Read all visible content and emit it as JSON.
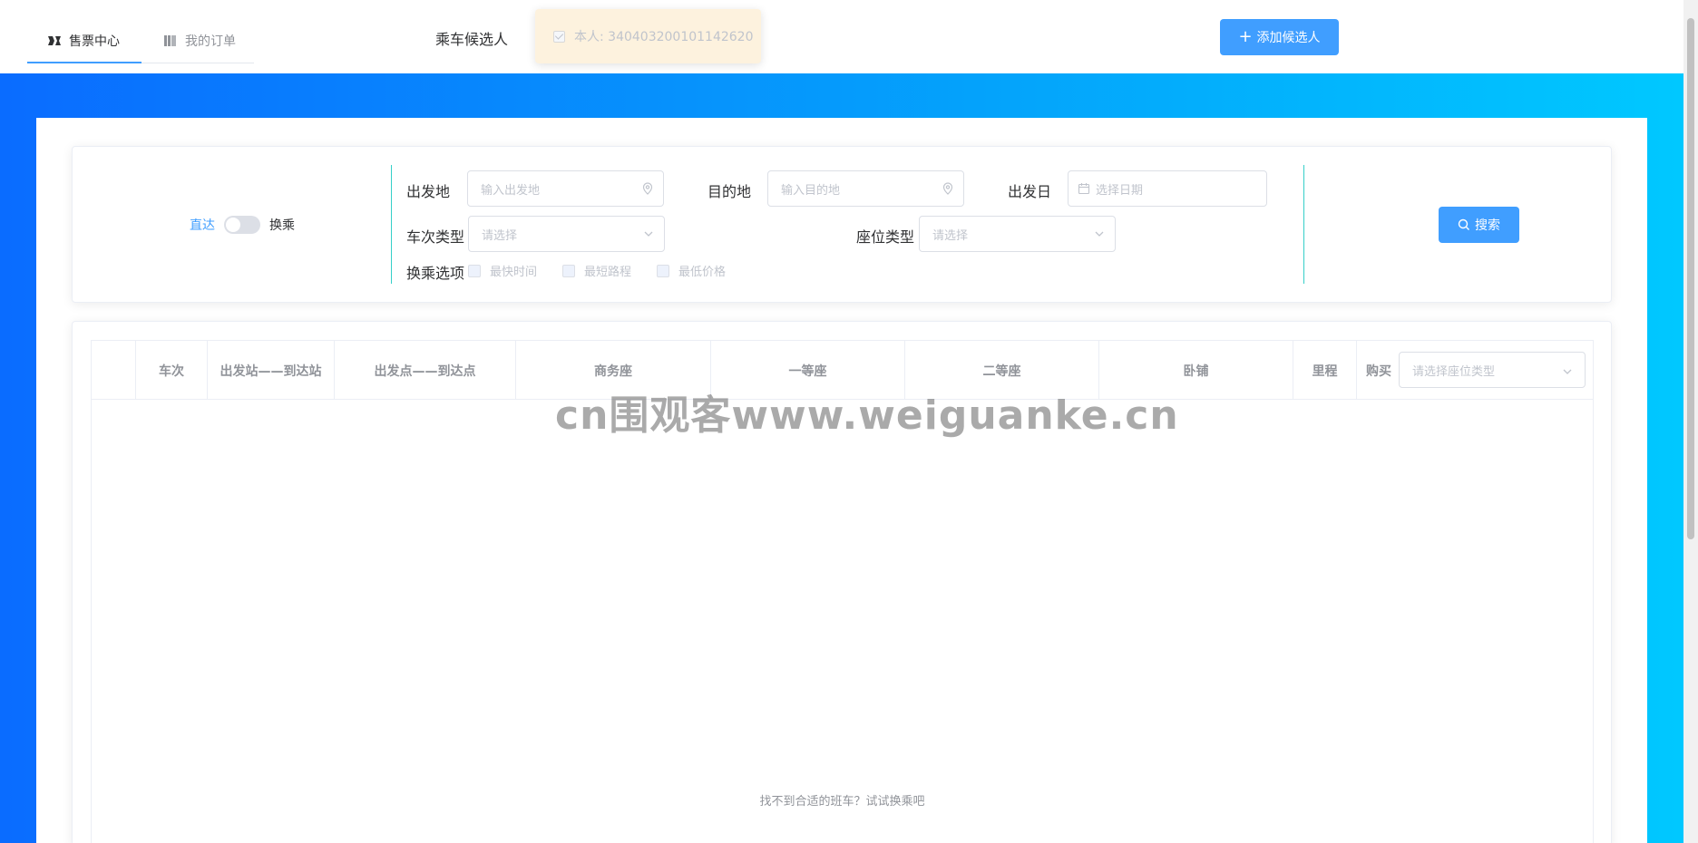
{
  "header": {
    "tabs": [
      {
        "label": "售票中心",
        "icon": "ticket-icon",
        "active": true
      },
      {
        "label": "我的订单",
        "icon": "orders-icon",
        "active": false
      }
    ],
    "passenger_label": "乘车候选人",
    "passenger_chip": "本人: 340403200101142620",
    "add_button": "添加候选人"
  },
  "search": {
    "switch_left": "直达",
    "switch_right": "换乘",
    "from_label": "出发地",
    "from_placeholder": "输入出发地",
    "to_label": "目的地",
    "to_placeholder": "输入目的地",
    "date_label": "出发日",
    "date_placeholder": "选择日期",
    "train_type_label": "车次类型",
    "train_type_placeholder": "请选择",
    "seat_type_label": "座位类型",
    "seat_type_placeholder": "请选择",
    "transfer_label": "换乘选项",
    "transfer_options": [
      "最快时间",
      "最短路程",
      "最低价格"
    ],
    "search_button": "搜索"
  },
  "table": {
    "columns": [
      "",
      "车次",
      "出发站——到达站",
      "出发点——到达点",
      "商务座",
      "一等座",
      "二等座",
      "卧铺",
      "里程",
      "购买"
    ],
    "seat_select_placeholder": "请选择座位类型",
    "empty_text": "找不到合适的班车？试试换乘吧"
  },
  "watermark": "cn围观客www.weiguanke.cn",
  "colors": {
    "primary": "#409eff",
    "gradient_start": "#0a6cff",
    "gradient_end": "#00c8ff",
    "divider": "#36cfc9",
    "chip_bg": "#fdf2de"
  }
}
